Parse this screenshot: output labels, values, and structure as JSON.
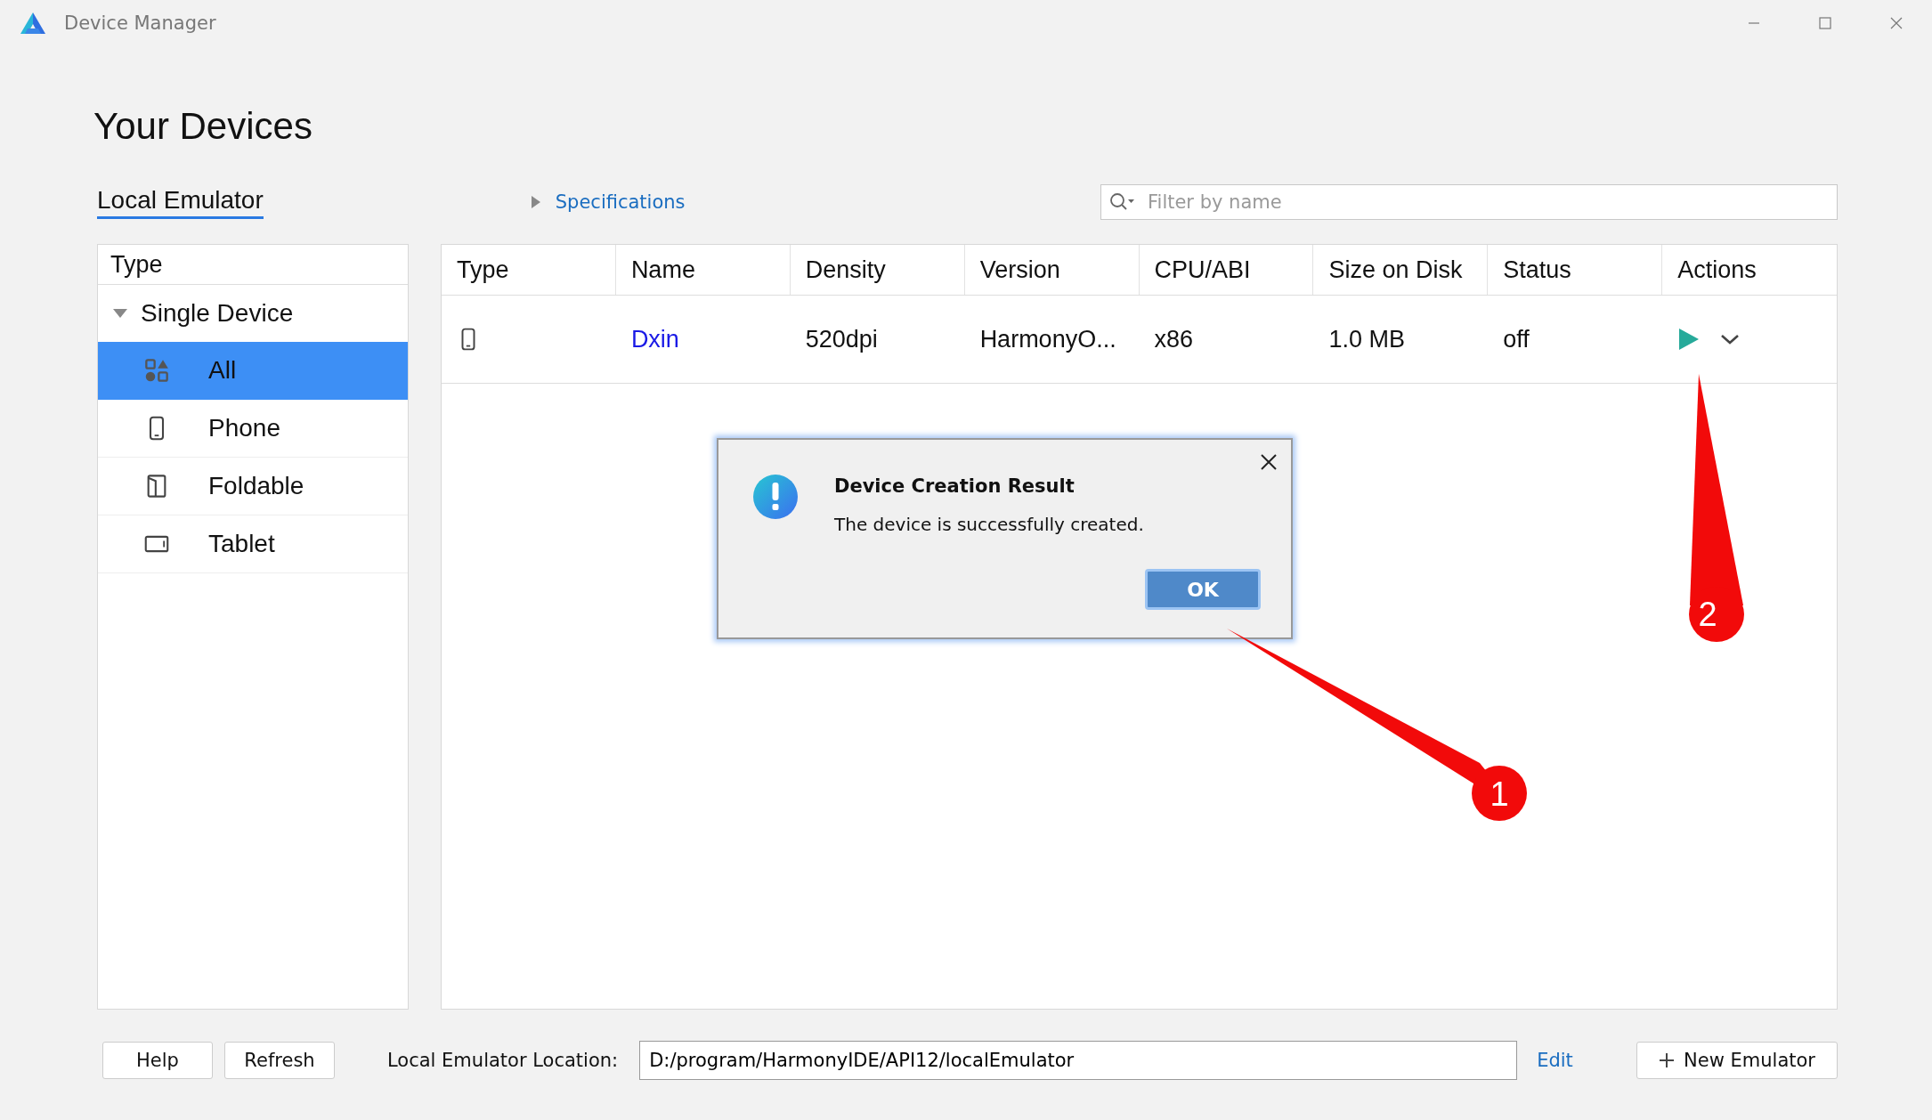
{
  "window": {
    "title": "Device Manager"
  },
  "heading": "Your Devices",
  "tabs": [
    {
      "label": "Local Emulator",
      "selected": true
    }
  ],
  "specifications": {
    "label": "Specifications",
    "expanded": false
  },
  "filter": {
    "placeholder": "Filter by name"
  },
  "sidebar": {
    "header": "Type",
    "groups": [
      {
        "label": "Single Device",
        "expanded": true,
        "children": [
          {
            "label": "All",
            "kind": "all",
            "selected": true
          },
          {
            "label": "Phone",
            "kind": "phone",
            "selected": false
          },
          {
            "label": "Foldable",
            "kind": "foldable",
            "selected": false
          },
          {
            "label": "Tablet",
            "kind": "tablet",
            "selected": false
          }
        ]
      }
    ]
  },
  "table": {
    "columns": [
      "Type",
      "Name",
      "Density",
      "Version",
      "CPU/ABI",
      "Size on Disk",
      "Status",
      "Actions"
    ],
    "rows": [
      {
        "kind": "phone",
        "name": "Dxin",
        "density": "520dpi",
        "version": "HarmonyO...",
        "cpu_abi": "x86",
        "size_on_disk": "1.0 MB",
        "status": "off"
      }
    ]
  },
  "dialog": {
    "title": "Device Creation Result",
    "message": "The device is successfully created.",
    "button": "OK"
  },
  "footer": {
    "buttons": [
      "Help",
      "Refresh"
    ],
    "location_label": "Local Emulator Location:",
    "location_value": "D:/program/HarmonyIDE/API12/localEmulator",
    "edit_link": "Edit",
    "new_button": "New Emulator"
  },
  "annotations": [
    {
      "label": "1"
    },
    {
      "label": "2"
    }
  ]
}
